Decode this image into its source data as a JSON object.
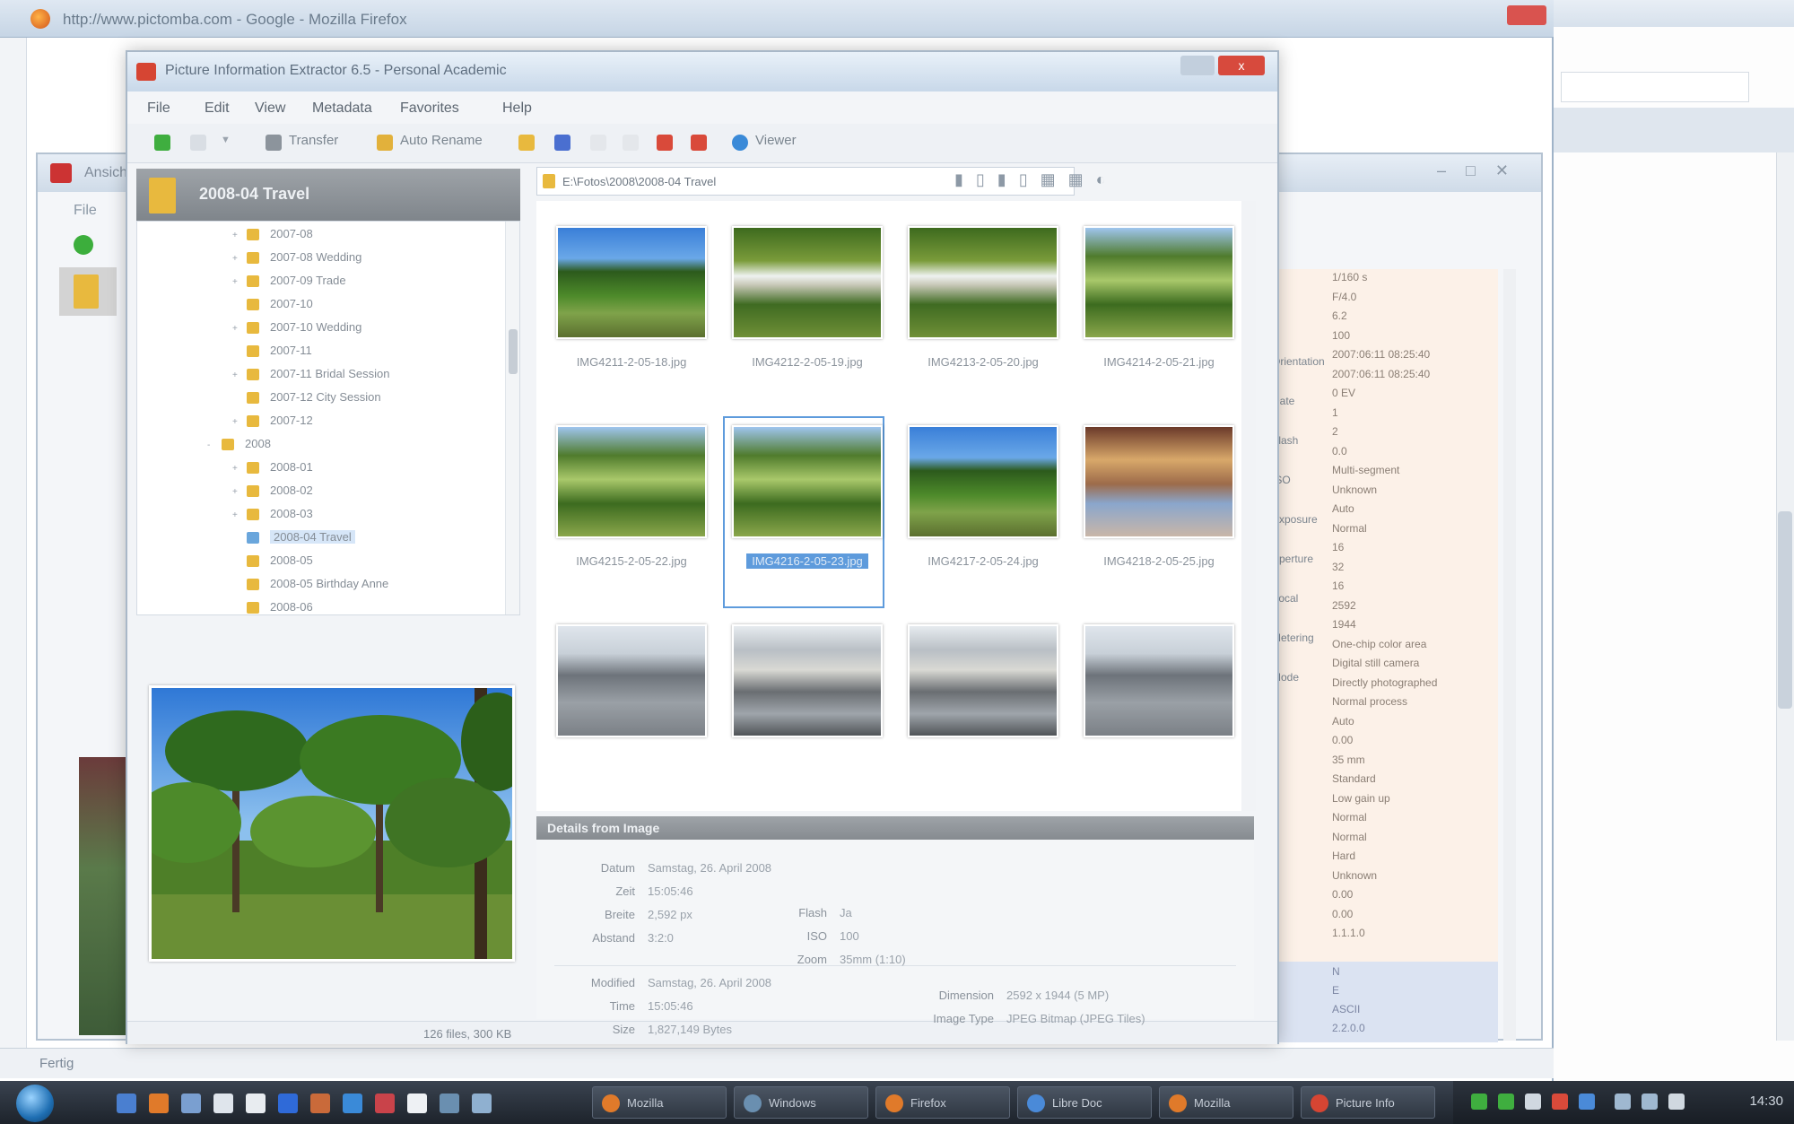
{
  "background_browser": {
    "title": "http://www.pictomba.com - Google - Mozilla Firefox",
    "status": "Fertig"
  },
  "exif_window": {
    "title": "Ansicht",
    "menu": "File",
    "labels": [
      "Orientation",
      "Date",
      "Flash",
      "ISO",
      "Exposure",
      "Aperture",
      "Focal",
      "Metering",
      "Mode"
    ],
    "values": [
      "1/160 s",
      "F/4.0",
      "6.2",
      "100",
      "2007:06:11 08:25:40",
      "2007:06:11 08:25:40",
      "0 EV",
      "1",
      "2",
      "0.0",
      "Multi-segment",
      "Unknown",
      "Auto",
      "Normal",
      "16",
      "32",
      "16",
      "2592",
      "1944",
      "One-chip color area",
      "Digital still camera",
      "Directly photographed",
      "Normal process",
      "Auto",
      "0.00",
      "35 mm",
      "Standard",
      "Low gain up",
      "Normal",
      "Normal",
      "Hard",
      "Unknown",
      "0.00",
      "0.00",
      "1.1.1.0"
    ],
    "blue_values": [
      "N",
      "E",
      "ASCII",
      "2.2.0.0"
    ]
  },
  "app": {
    "title": "Picture Information Extractor 6.5 - Personal Academic",
    "close": "x",
    "menu": [
      "File",
      "Edit",
      "View",
      "Metadata",
      "Favorites",
      "Help"
    ],
    "toolbar": {
      "transfer": "Transfer",
      "auto_rename": "Auto Rename",
      "viewer": "Viewer"
    },
    "folder_pane": {
      "title": "2008-04 Travel",
      "tree": [
        {
          "label": "2007-08",
          "depth": 2,
          "exp": "+"
        },
        {
          "label": "2007-08 Wedding",
          "depth": 2,
          "exp": "+"
        },
        {
          "label": "2007-09 Trade",
          "depth": 2,
          "exp": "+"
        },
        {
          "label": "2007-10",
          "depth": 2,
          "exp": ""
        },
        {
          "label": "2007-10 Wedding",
          "depth": 2,
          "exp": "+"
        },
        {
          "label": "2007-11",
          "depth": 2,
          "exp": ""
        },
        {
          "label": "2007-11 Bridal Session",
          "depth": 2,
          "exp": "+"
        },
        {
          "label": "2007-12 City Session",
          "depth": 2,
          "exp": ""
        },
        {
          "label": "2007-12",
          "depth": 2,
          "exp": "+"
        },
        {
          "label": "2008",
          "depth": 1,
          "exp": "-"
        },
        {
          "label": "2008-01",
          "depth": 2,
          "exp": "+"
        },
        {
          "label": "2008-02",
          "depth": 2,
          "exp": "+"
        },
        {
          "label": "2008-03",
          "depth": 2,
          "exp": "+"
        },
        {
          "label": "2008-04 Travel",
          "depth": 2,
          "exp": "",
          "selected": true
        },
        {
          "label": "2008-05",
          "depth": 2,
          "exp": ""
        },
        {
          "label": "2008-05 Birthday Anne",
          "depth": 2,
          "exp": ""
        },
        {
          "label": "2008-06",
          "depth": 2,
          "exp": ""
        }
      ]
    },
    "path": "E:\\Fotos\\2008\\2008-04 Travel",
    "thumbnails": [
      {
        "caption": "IMG4211-2-05-18.jpg",
        "kind": "palm"
      },
      {
        "caption": "IMG4212-2-05-19.jpg",
        "kind": "palm2"
      },
      {
        "caption": "IMG4213-2-05-20.jpg",
        "kind": "palm2"
      },
      {
        "caption": "IMG4214-2-05-21.jpg",
        "kind": "palm3"
      },
      {
        "caption": "IMG4215-2-05-22.jpg",
        "kind": "palm3"
      },
      {
        "caption": "IMG4216-2-05-23.jpg",
        "kind": "palm3",
        "selected": true
      },
      {
        "caption": "IMG4217-2-05-24.jpg",
        "kind": "palm"
      },
      {
        "caption": "IMG4218-2-05-25.jpg",
        "kind": "room"
      },
      {
        "caption": "",
        "kind": "street"
      },
      {
        "caption": "",
        "kind": "bldg"
      },
      {
        "caption": "",
        "kind": "bldg"
      },
      {
        "caption": "",
        "kind": "street"
      }
    ],
    "info_panel": {
      "title": "Details from Image",
      "rows_top": [
        {
          "label": "Datum",
          "value": "Samstag, 26. April 2008"
        },
        {
          "label": "Zeit",
          "value": "15:05:46"
        },
        {
          "label": "Breite",
          "value": "2,592 px"
        },
        {
          "label": "Abstand",
          "value": "3:2:0"
        }
      ],
      "rows_top_right": [
        {
          "label": "Flash",
          "value": "Ja"
        },
        {
          "label": "ISO",
          "value": "100"
        },
        {
          "label": "Zoom",
          "value": "35mm (1:10)"
        }
      ],
      "rows_bottom": [
        {
          "label": "Modified",
          "value": "Samstag, 26. April 2008"
        },
        {
          "label": "Time",
          "value": "15:05:46"
        },
        {
          "label": "Size",
          "value": "1,827,149 Bytes"
        }
      ],
      "rows_bottom_right": [
        {
          "label": "Dimension",
          "value": "2592 x 1944 (5 MP)"
        },
        {
          "label": "Image Type",
          "value": "JPEG Bitmap (JPEG Tiles)"
        }
      ]
    },
    "statusbar": "126 files, 300 KB"
  },
  "taskbar": {
    "tasks": [
      "Mozilla",
      "Windows",
      "Firefox",
      "Libre Doc",
      "Mozilla",
      "Picture Info"
    ],
    "clock": "14:30"
  }
}
